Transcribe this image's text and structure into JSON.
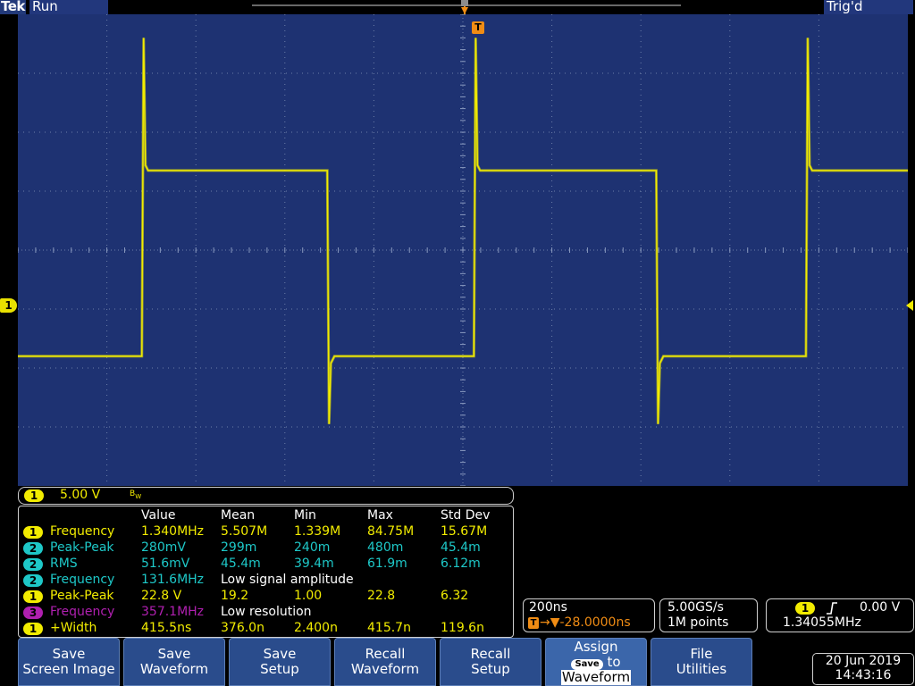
{
  "header": {
    "brand": "Tek",
    "state": "Run",
    "trigger_status": "Trig'd",
    "trigger_marker": "T"
  },
  "channel_marker": "1",
  "scale_bar": {
    "channel": "1",
    "volts_per_div": "5.00 V",
    "bw_icon": "bandwidth-limit-icon"
  },
  "measurements": {
    "columns": [
      "Value",
      "Mean",
      "Min",
      "Max",
      "Std Dev"
    ],
    "rows": [
      {
        "ch": "1",
        "color": "#f2ec00",
        "name": "Frequency",
        "value": "1.340MHz",
        "mean": "5.507M",
        "min": "1.339M",
        "max": "84.75M",
        "std": "15.67M",
        "note": ""
      },
      {
        "ch": "2",
        "color": "#1ec8c8",
        "name": "Peak-Peak",
        "value": "280mV",
        "mean": "299m",
        "min": "240m",
        "max": "480m",
        "std": "45.4m",
        "note": ""
      },
      {
        "ch": "2",
        "color": "#1ec8c8",
        "name": "RMS",
        "value": "51.6mV",
        "mean": "45.4m",
        "min": "39.4m",
        "max": "61.9m",
        "std": "6.12m",
        "note": ""
      },
      {
        "ch": "2",
        "color": "#1ec8c8",
        "name": "Frequency",
        "value": "131.6MHz",
        "mean": "",
        "min": "",
        "max": "",
        "std": "",
        "note": "Low signal amplitude"
      },
      {
        "ch": "1",
        "color": "#f2ec00",
        "name": "Peak-Peak",
        "value": "22.8 V",
        "mean": "19.2",
        "min": "1.00",
        "max": "22.8",
        "std": "6.32",
        "note": ""
      },
      {
        "ch": "3",
        "color": "#b020b0",
        "name": "Frequency",
        "value": "357.1MHz",
        "mean": "",
        "min": "",
        "max": "",
        "std": "",
        "note": "Low resolution"
      },
      {
        "ch": "1",
        "color": "#f2ec00",
        "name": "+Width",
        "value": "415.5ns",
        "mean": "376.0n",
        "min": "2.400n",
        "max": "415.7n",
        "std": "119.6n",
        "note": ""
      }
    ]
  },
  "horizontal": {
    "time_per_div": "200ns",
    "position": "→▼-28.0000ns",
    "sample_rate": "5.00GS/s",
    "record_length": "1M points",
    "trigger_channel": "1",
    "trigger_level": "0.00 V",
    "trigger_freq": "1.34055MHz"
  },
  "buttons": {
    "save_screen": "Save\nScreen Image",
    "save_waveform": "Save\nWaveform",
    "save_setup": "Save\nSetup",
    "recall_waveform": "Recall\nWaveform",
    "recall_setup": "Recall\nSetup",
    "assign_line1": "Assign",
    "assign_pill": "Save",
    "assign_to": "to",
    "assign_line3": "Waveform",
    "file_utilities": "File\nUtilities"
  },
  "datetime": {
    "date": "20 Jun  2019",
    "time": "14:43:16"
  },
  "colors": {
    "ch1": "#f2ec00",
    "ch2": "#1ec8c8",
    "ch3": "#b020b0",
    "graticule_bg": "#1e3272",
    "button_bg": "#2a4c8c",
    "trigger_orange": "#f08c14"
  },
  "waveform": {
    "type": "square",
    "channel": "1",
    "frequency": "1.340MHz",
    "rising_edge_times_ns": [
      -717.4,
      28.8,
      775.0
    ],
    "falling_edge_times_ns": [
      -300.7,
      438.6
    ],
    "high_level_div": 1.35,
    "low_level_div": -1.8,
    "overshoot_high_div": 3.6,
    "overshoot_low_div": -2.95
  }
}
